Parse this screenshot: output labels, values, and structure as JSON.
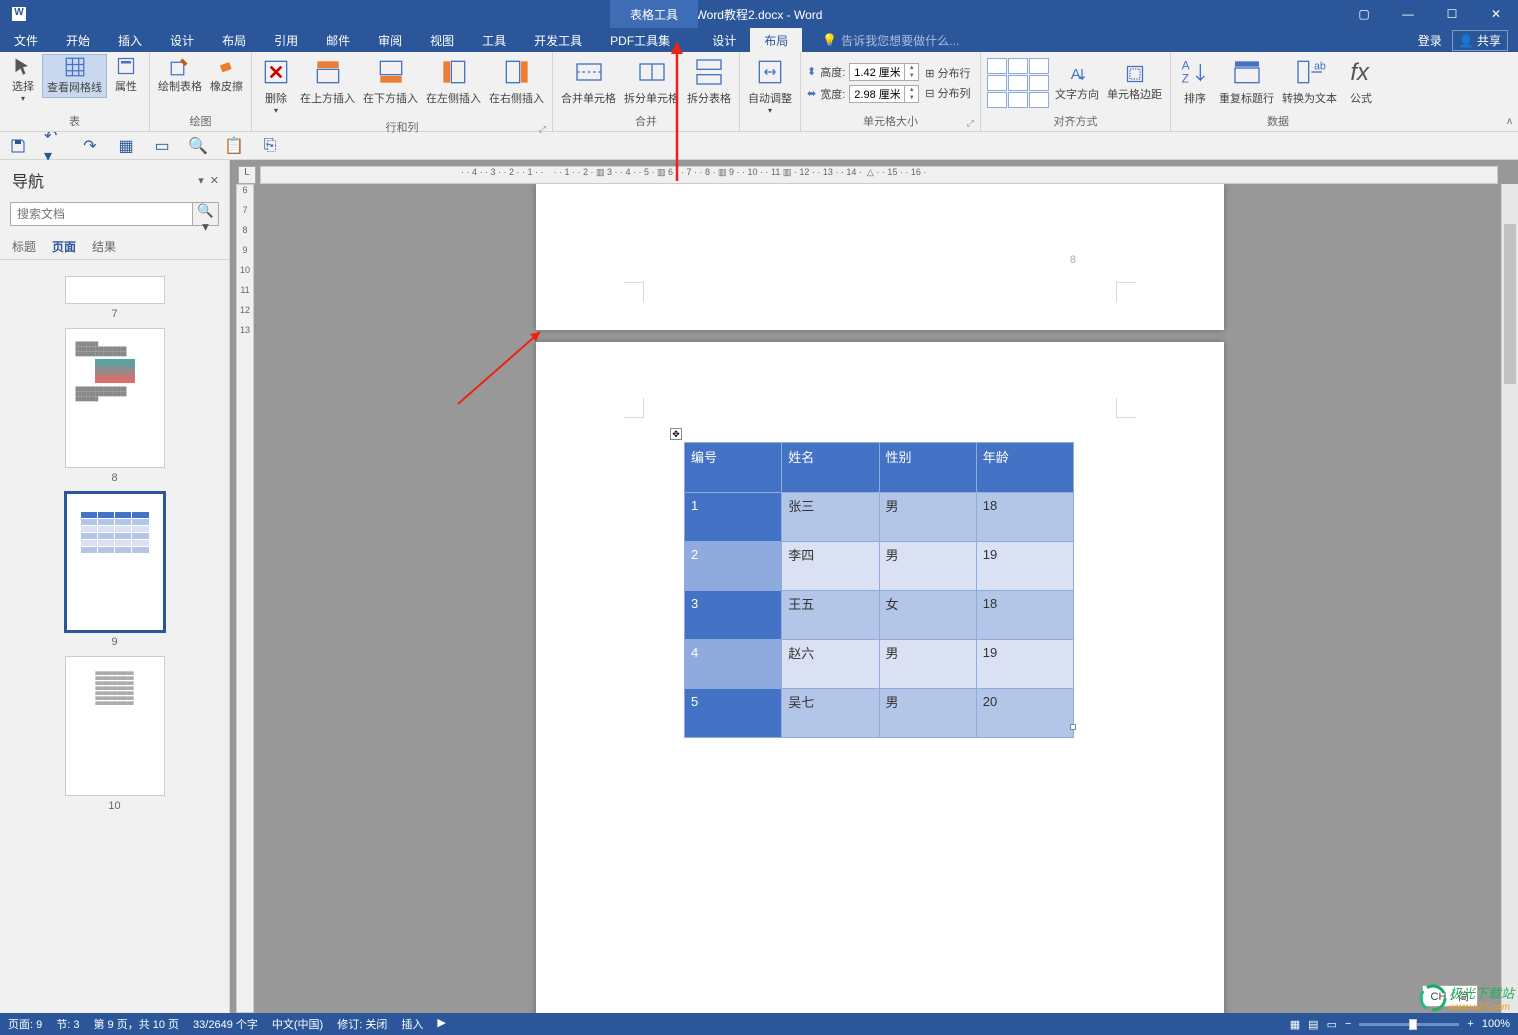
{
  "title": {
    "doc_name": "Word教程2.docx - Word",
    "tool_tab": "表格工具"
  },
  "window_buttons": {
    "ribbon_opts": "▢",
    "minimize": "—",
    "maximize": "☐",
    "close": "✕"
  },
  "menu": {
    "tabs": [
      "文件",
      "开始",
      "插入",
      "设计",
      "布局",
      "引用",
      "邮件",
      "审阅",
      "视图",
      "工具",
      "开发工具",
      "PDF工具集",
      "设计",
      "布局"
    ],
    "active_index": 13,
    "tell_me": "告诉我您想要做什么...",
    "sign_in": "登录",
    "share": "共享"
  },
  "ribbon": {
    "groups": {
      "table": {
        "label": "表",
        "select": "选择",
        "view_grid": "查看网格线",
        "properties": "属性"
      },
      "draw": {
        "label": "绘图",
        "draw_table": "绘制表格",
        "eraser": "橡皮擦"
      },
      "rows_cols": {
        "label": "行和列",
        "delete": "删除",
        "insert_above": "在上方插入",
        "insert_below": "在下方插入",
        "insert_left": "在左侧插入",
        "insert_right": "在右侧插入"
      },
      "merge": {
        "label": "合并",
        "merge_cells": "合并单元格",
        "split_cells": "拆分单元格",
        "split_table": "拆分表格"
      },
      "autofit": {
        "label": "",
        "autofit": "自动调整"
      },
      "cell_size": {
        "label": "单元格大小",
        "height_label": "高度:",
        "height_value": "1.42 厘米",
        "width_label": "宽度:",
        "width_value": "2.98 厘米",
        "dist_rows": "分布行",
        "dist_cols": "分布列"
      },
      "alignment": {
        "label": "对齐方式",
        "text_dir": "文字方向",
        "cell_margins": "单元格边距"
      },
      "data": {
        "label": "数据",
        "sort": "排序",
        "repeat_header": "重复标题行",
        "to_text": "转换为文本",
        "formula": "公式"
      }
    }
  },
  "nav": {
    "title": "导航",
    "search_placeholder": "搜索文档",
    "tabs": [
      "标题",
      "页面",
      "结果"
    ],
    "active_tab": 1,
    "pages": [
      {
        "num": "7"
      },
      {
        "num": "8"
      },
      {
        "num": "9"
      },
      {
        "num": "10"
      }
    ],
    "selected_page": 2
  },
  "ruler_corner": "L",
  "doc_table": {
    "headers": [
      "编号",
      "姓名",
      "性别",
      "年龄"
    ],
    "rows": [
      [
        "1",
        "张三",
        "男",
        "18"
      ],
      [
        "2",
        "李四",
        "男",
        "19"
      ],
      [
        "3",
        "王五",
        "女",
        "18"
      ],
      [
        "4",
        "赵六",
        "男",
        "19"
      ],
      [
        "5",
        "吴七",
        "男",
        "20"
      ]
    ],
    "page_indicator": "8"
  },
  "status": {
    "page": "页面: 9",
    "section": "节: 3",
    "page_of": "第 9 页，共 10 页",
    "words": "33/2649 个字",
    "lang": "中文(中国)",
    "track": "修订: 关闭",
    "insert": "插入",
    "zoom": "100%"
  },
  "ime": "CH ♪ 简",
  "watermark": {
    "main": "极光下载站",
    "sub": "www.xz7.com"
  }
}
